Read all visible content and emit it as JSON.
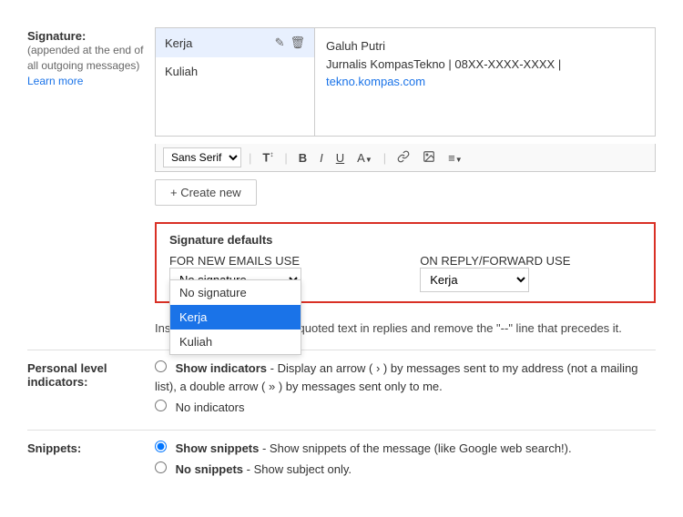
{
  "signature": {
    "label": "Signature:",
    "sublabel": "(appended at the end of all outgoing messages)",
    "learn_more": "Learn more",
    "items": [
      {
        "name": "Kerja",
        "active": true
      },
      {
        "name": "Kuliah",
        "active": false
      }
    ],
    "preview": {
      "line1": "Galuh Putri",
      "line2": "Jurnalis KompasTekno | 08XX-XXXX-XXXX |",
      "link": "tekno.kompas.com"
    },
    "toolbar": {
      "font": "Sans Serif",
      "font_size_icon": "T↕",
      "bold": "B",
      "italic": "I",
      "underline": "U",
      "font_color": "A",
      "link": "🔗",
      "image": "🖼",
      "align": "≡"
    },
    "create_new": "+ Create new"
  },
  "signature_defaults": {
    "title": "Signature defaults",
    "new_emails_label": "FOR NEW EMAILS USE",
    "reply_label": "ON REPLY/FORWARD USE",
    "new_emails_value": "No signature",
    "reply_value": "Kerja",
    "dropdown_options": [
      "No signature",
      "Kerja",
      "Kuliah"
    ],
    "reply_options": [
      "No signature",
      "Kerja",
      "Kuliah"
    ],
    "quoted_text": "Insert this signature before quoted text in replies and remove the \"--\" line that precedes it."
  },
  "personal_level": {
    "label": "Personal level\nindicators:",
    "show_label": "Show indicators",
    "show_desc": "- Display an arrow ( › ) by messages sent to my address (not a mailing list), a double arrow ( » ) by messages sent only to me.",
    "no_label": "No indicators"
  },
  "snippets": {
    "label": "Snippets:",
    "show_label": "Show snippets",
    "show_desc": "- Show snippets of the message (like Google web search!).",
    "no_label": "No snippets",
    "no_desc": "- Show subject only."
  }
}
